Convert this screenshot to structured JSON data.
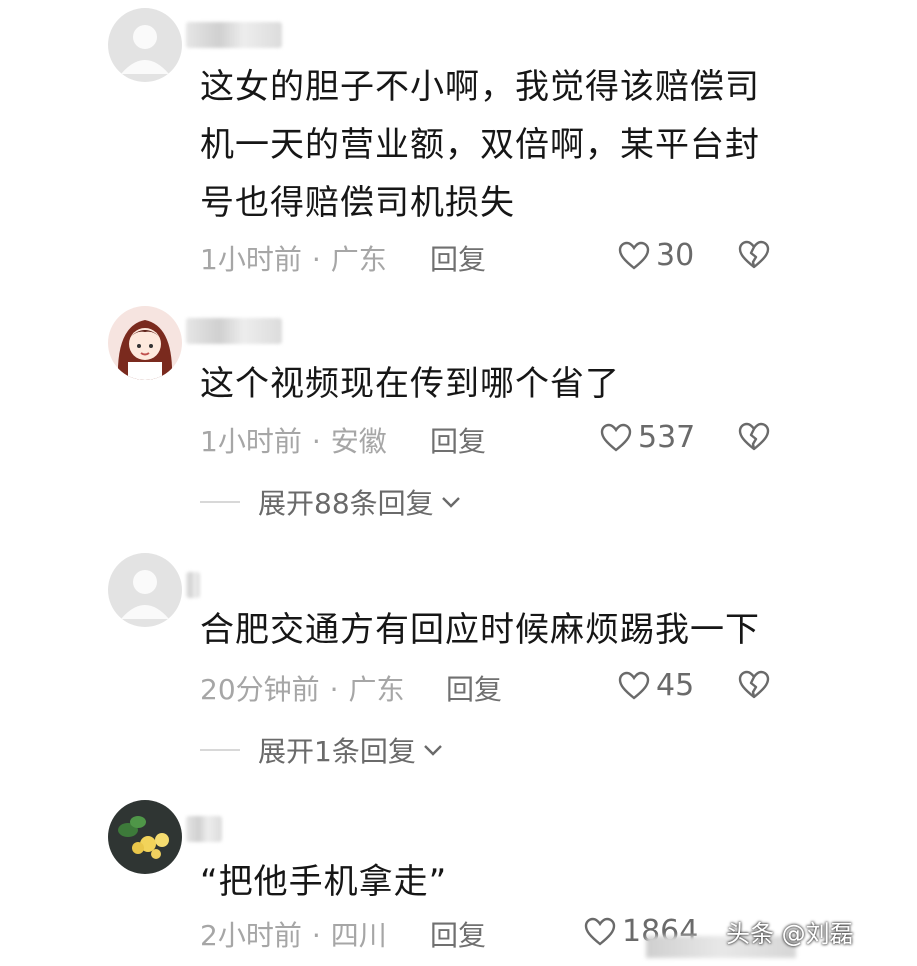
{
  "comments": [
    {
      "text": "这女的胆子不小啊，我觉得该赔偿司机一天的营业额，双倍啊，某平台封号也得赔偿司机损失",
      "time": "1小时前",
      "location": "广东",
      "reply": "回复",
      "likes": "30"
    },
    {
      "text": "这个视频现在传到哪个省了",
      "time": "1小时前",
      "location": "安徽",
      "reply": "回复",
      "likes": "537",
      "expand": "展开88条回复"
    },
    {
      "text": "合肥交通方有回应时候麻烦踢我一下",
      "time": "20分钟前",
      "location": "广东",
      "reply": "回复",
      "likes": "45",
      "expand": "展开1条回复"
    },
    {
      "text": "“把他手机拿走”",
      "time": "2小时前",
      "location": "四川",
      "reply": "回复",
      "likes": "1864"
    }
  ],
  "separator": "·",
  "watermark": "头条 @刘磊",
  "icons": {
    "like": "heart-icon",
    "dislike": "broken-heart-icon",
    "expand": "chevron-down-icon"
  },
  "colors": {
    "text": "#161616",
    "meta": "#a6a6a6",
    "action": "#6a6a6a"
  }
}
